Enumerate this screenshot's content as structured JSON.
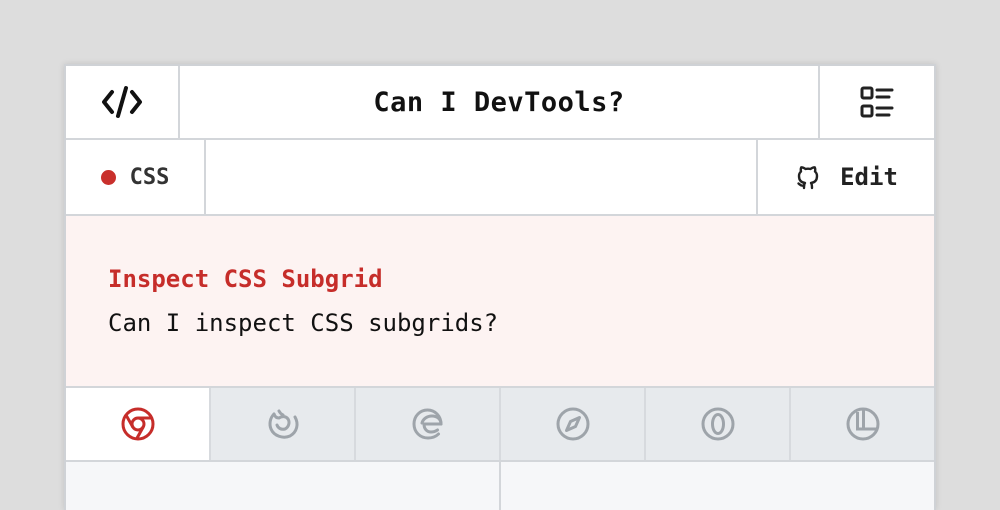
{
  "header": {
    "title": "Can I DevTools?",
    "logo_icon": "code-slash-icon",
    "menu_icon": "list-menu-icon"
  },
  "subbar": {
    "category": "CSS",
    "category_color": "#c9302c",
    "edit_label": "Edit",
    "edit_icon": "github-icon"
  },
  "feature": {
    "title": "Inspect CSS Subgrid",
    "description": "Can I inspect CSS subgrids?",
    "accent_color": "#c62d2a"
  },
  "browser_tabs": [
    {
      "name": "chrome",
      "icon": "chrome-icon",
      "active": true
    },
    {
      "name": "firefox",
      "icon": "firefox-icon",
      "active": false
    },
    {
      "name": "edge",
      "icon": "edge-icon",
      "active": false
    },
    {
      "name": "safari",
      "icon": "safari-icon",
      "active": false
    },
    {
      "name": "opera",
      "icon": "opera-icon",
      "active": false
    },
    {
      "name": "polypane",
      "icon": "polypane-icon",
      "active": false
    }
  ]
}
